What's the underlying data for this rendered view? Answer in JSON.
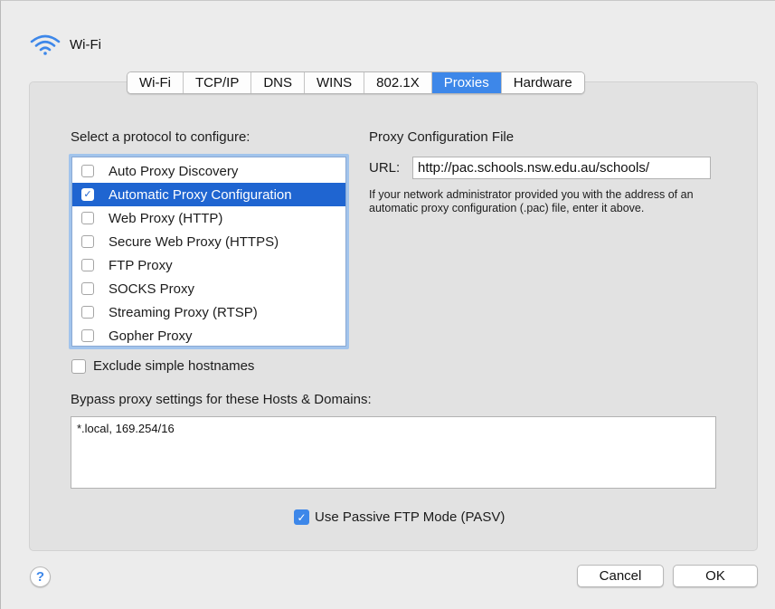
{
  "window": {
    "title": "Wi-Fi"
  },
  "tabs": [
    {
      "label": "Wi-Fi"
    },
    {
      "label": "TCP/IP"
    },
    {
      "label": "DNS"
    },
    {
      "label": "WINS"
    },
    {
      "label": "802.1X"
    },
    {
      "label": "Proxies",
      "active": true
    },
    {
      "label": "Hardware"
    }
  ],
  "protocols": {
    "heading": "Select a protocol to configure:",
    "items": [
      {
        "label": "Auto Proxy Discovery",
        "checked": false,
        "selected": false
      },
      {
        "label": "Automatic Proxy Configuration",
        "checked": true,
        "selected": true
      },
      {
        "label": "Web Proxy (HTTP)",
        "checked": false,
        "selected": false
      },
      {
        "label": "Secure Web Proxy (HTTPS)",
        "checked": false,
        "selected": false
      },
      {
        "label": "FTP Proxy",
        "checked": false,
        "selected": false
      },
      {
        "label": "SOCKS Proxy",
        "checked": false,
        "selected": false
      },
      {
        "label": "Streaming Proxy (RTSP)",
        "checked": false,
        "selected": false
      },
      {
        "label": "Gopher Proxy",
        "checked": false,
        "selected": false
      }
    ]
  },
  "proxy_config": {
    "heading": "Proxy Configuration File",
    "url_label": "URL:",
    "url_value": "http://pac.schools.nsw.edu.au/schools/",
    "help": "If your network administrator provided you with the address of an automatic proxy configuration (.pac) file, enter it above."
  },
  "exclude_simple": {
    "label": "Exclude simple hostnames",
    "checked": false
  },
  "bypass": {
    "heading": "Bypass proxy settings for these Hosts & Domains:",
    "value": "*.local, 169.254/16"
  },
  "passive_ftp": {
    "label": "Use Passive FTP Mode (PASV)",
    "checked": true
  },
  "buttons": {
    "help": "?",
    "cancel": "Cancel",
    "ok": "OK"
  },
  "colors": {
    "accent": "#3d87e9",
    "selection": "#1f65d1"
  }
}
